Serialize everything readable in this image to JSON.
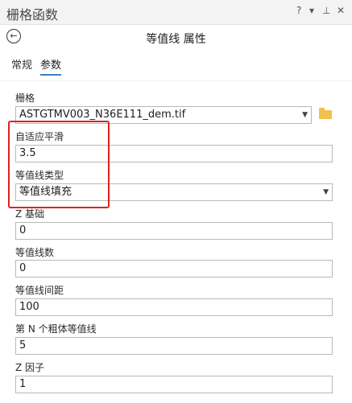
{
  "window": {
    "title": "栅格函数",
    "help": "?",
    "menu": "▾",
    "pin": "⊥",
    "close": "✕"
  },
  "header": {
    "title": "等值线 属性"
  },
  "tabs": [
    {
      "label": "常规"
    },
    {
      "label": "参数"
    }
  ],
  "params": {
    "raster": {
      "label": "栅格",
      "value": "ASTGTMV003_N36E111_dem.tif"
    },
    "smoothing": {
      "label": "自适应平滑",
      "value": "3.5"
    },
    "contour_type": {
      "label": "等值线类型",
      "value": "等值线填充"
    },
    "z_base": {
      "label": "Z 基础",
      "value": "0"
    },
    "contour_count": {
      "label": "等值线数",
      "value": "0"
    },
    "contour_interval": {
      "label": "等值线间距",
      "value": "100"
    },
    "nth_contour": {
      "label": "第 N 个粗体等值线",
      "value": "5"
    },
    "z_factor": {
      "label": "Z 因子",
      "value": "1"
    }
  },
  "icons": {
    "back": "back-arrow-icon",
    "folder": "folder-icon",
    "dropdown": "chevron-down-icon"
  },
  "colors": {
    "highlight": "#e02020",
    "active_tab": "#3a7fc4"
  }
}
